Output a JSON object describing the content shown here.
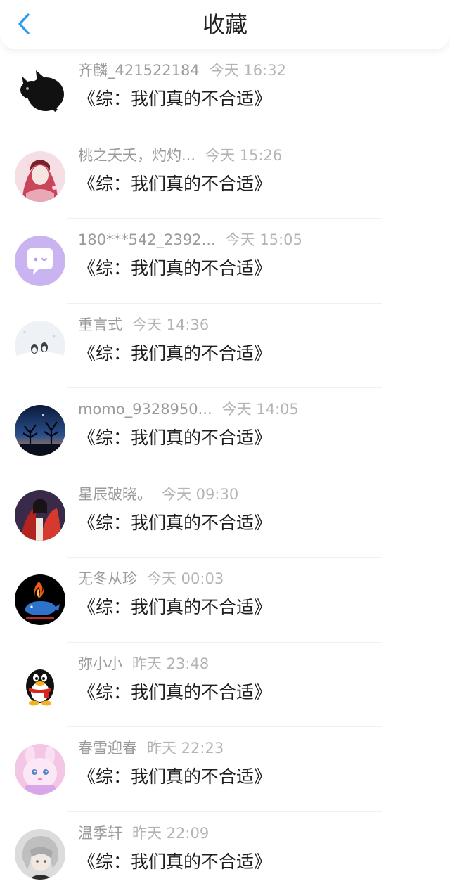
{
  "header": {
    "title": "收藏",
    "back_icon": "chevron-left-icon",
    "accent_color": "#2d9cf0"
  },
  "items": [
    {
      "name": "齐麟_421522184",
      "time": "今天 16:32",
      "title": "《综：我们真的不合适》",
      "avatar": "black-cat-avatar"
    },
    {
      "name": "桃之夭夭，灼灼...",
      "time": "今天 15:26",
      "title": "《综：我们真的不合适》",
      "avatar": "pink-anime-avatar"
    },
    {
      "name": "180***542_2392...",
      "time": "今天 15:05",
      "title": "《综：我们真的不合适》",
      "avatar": "purple-chat-avatar"
    },
    {
      "name": "重言式",
      "time": "今天 14:36",
      "title": "《综：我们真的不合适》",
      "avatar": "snow-birds-avatar"
    },
    {
      "name": "momo_9328950...",
      "time": "今天 14:05",
      "title": "《综：我们真的不合适》",
      "avatar": "night-sky-avatar"
    },
    {
      "name": "星辰破晓。",
      "time": "今天 09:30",
      "title": "《综：我们真的不合适》",
      "avatar": "red-robe-avatar"
    },
    {
      "name": "无冬从珍",
      "time": "今天 00:03",
      "title": "《综：我们真的不合适》",
      "avatar": "fire-whale-avatar"
    },
    {
      "name": "弥小小",
      "time": "昨天 23:48",
      "title": "《综：我们真的不合适》",
      "avatar": "penguin-avatar"
    },
    {
      "name": "春雪迎春",
      "time": "昨天 22:23",
      "title": "《综：我们真的不合适》",
      "avatar": "pink-bunny-avatar"
    },
    {
      "name": "温季轩",
      "time": "昨天 22:09",
      "title": "《综：我们真的不合适》",
      "avatar": "silver-hair-avatar"
    }
  ]
}
